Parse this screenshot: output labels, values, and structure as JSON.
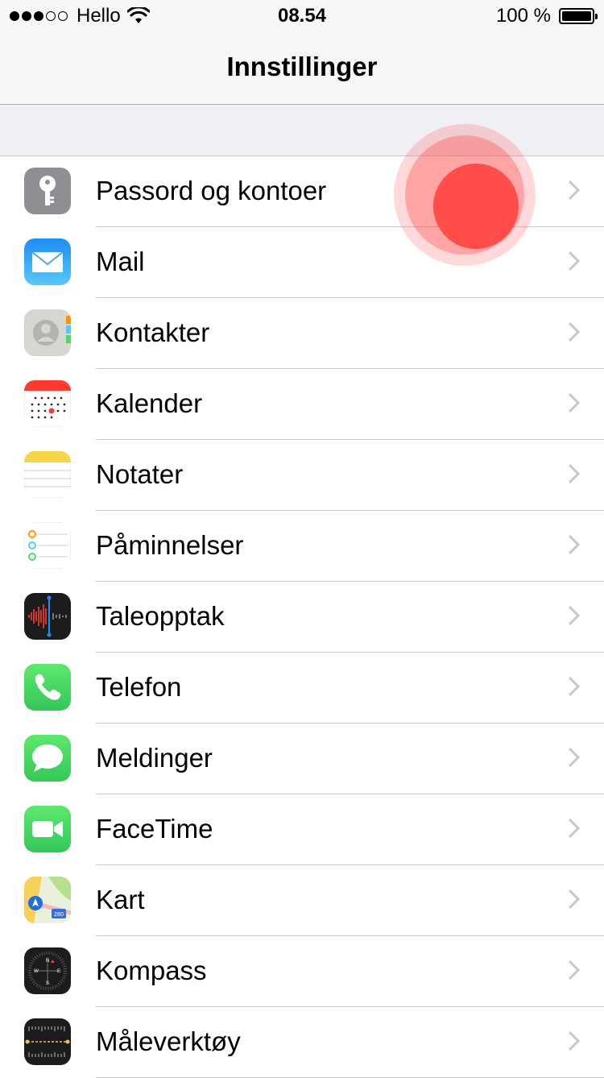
{
  "status_bar": {
    "carrier": "Hello",
    "time": "08.54",
    "battery": "100 %",
    "signal_bars_filled": 3,
    "signal_bars_total": 5
  },
  "navbar": {
    "title": "Innstillinger"
  },
  "settings_items": [
    {
      "label": "Passord og kontoer",
      "icon": "key-icon"
    },
    {
      "label": "Mail",
      "icon": "mail-icon"
    },
    {
      "label": "Kontakter",
      "icon": "contacts-icon"
    },
    {
      "label": "Kalender",
      "icon": "calendar-icon"
    },
    {
      "label": "Notater",
      "icon": "notes-icon"
    },
    {
      "label": "Påminnelser",
      "icon": "reminders-icon"
    },
    {
      "label": "Taleopptak",
      "icon": "voice-memos-icon"
    },
    {
      "label": "Telefon",
      "icon": "phone-icon"
    },
    {
      "label": "Meldinger",
      "icon": "messages-icon"
    },
    {
      "label": "FaceTime",
      "icon": "facetime-icon"
    },
    {
      "label": "Kart",
      "icon": "maps-icon"
    },
    {
      "label": "Kompass",
      "icon": "compass-icon"
    },
    {
      "label": "Måleverktøy",
      "icon": "measure-icon"
    }
  ],
  "colors": {
    "touch_indicator": "#ff4d4a",
    "separator": "#c8c7cc",
    "group_background": "#efeff4"
  }
}
